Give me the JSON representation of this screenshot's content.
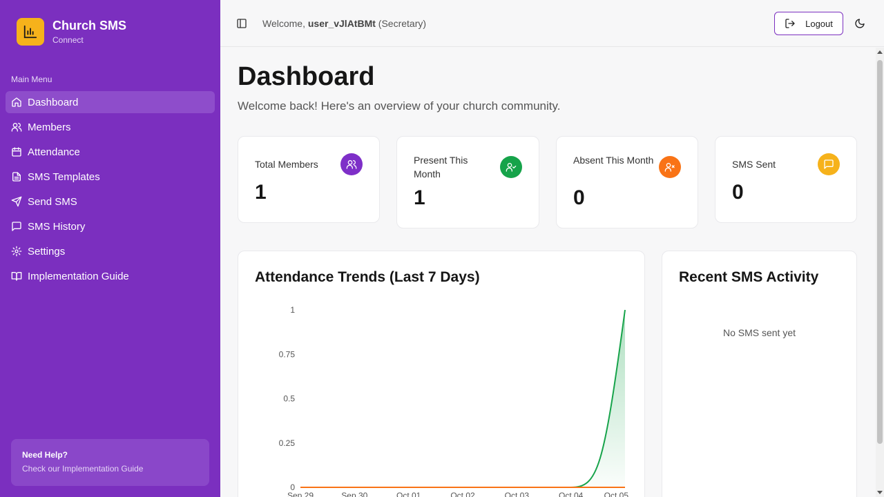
{
  "brand": {
    "title": "Church SMS",
    "subtitle": "Connect"
  },
  "sidebar": {
    "menu_label": "Main Menu",
    "items": [
      {
        "label": "Dashboard",
        "icon": "home-icon",
        "active": true
      },
      {
        "label": "Members",
        "icon": "users-icon"
      },
      {
        "label": "Attendance",
        "icon": "calendar-icon"
      },
      {
        "label": "SMS Templates",
        "icon": "file-text-icon"
      },
      {
        "label": "Send SMS",
        "icon": "send-icon"
      },
      {
        "label": "SMS History",
        "icon": "message-square-icon"
      },
      {
        "label": "Settings",
        "icon": "gear-icon"
      },
      {
        "label": "Implementation Guide",
        "icon": "book-open-icon"
      }
    ],
    "help": {
      "title": "Need Help?",
      "link": "Check our Implementation Guide"
    }
  },
  "header": {
    "welcome_prefix": "Welcome,",
    "username": "user_vJlAtBMt",
    "role": "(Secretary)",
    "logout_label": "Logout"
  },
  "main": {
    "title": "Dashboard",
    "subtitle": "Welcome back! Here's an overview of your church community."
  },
  "stats": [
    {
      "label": "Total Members",
      "value": "1",
      "icon": "users-icon",
      "color": "#7e2fc8"
    },
    {
      "label": "Present This Month",
      "value": "1",
      "icon": "user-check-icon",
      "color": "#16a34a"
    },
    {
      "label": "Absent This Month",
      "value": "0",
      "icon": "user-x-icon",
      "color": "#f97316"
    },
    {
      "label": "SMS Sent",
      "value": "0",
      "icon": "message-square-icon",
      "color": "#f6b21b"
    }
  ],
  "attendance_panel": {
    "title": "Attendance Trends (Last 7 Days)"
  },
  "sms_panel": {
    "title": "Recent SMS Activity",
    "empty": "No SMS sent yet"
  },
  "colors": {
    "sidebar": "#7b2fbf",
    "present": "#16a34a",
    "absent": "#f97316"
  },
  "chart_data": {
    "type": "area",
    "title": "Attendance Trends (Last 7 Days)",
    "categories": [
      "Sep 29",
      "Sep 30",
      "Oct 01",
      "Oct 02",
      "Oct 03",
      "Oct 04",
      "Oct 05"
    ],
    "yticks": [
      "0",
      "0.25",
      "0.5",
      "0.75",
      "1"
    ],
    "ylim": [
      0,
      1
    ],
    "series": [
      {
        "values": [
          0,
          0,
          0,
          0,
          0,
          0,
          1
        ],
        "color": "#16a34a"
      },
      {
        "values": [
          0,
          0,
          0,
          0,
          0,
          0,
          0
        ],
        "color": "#f97316"
      }
    ]
  }
}
